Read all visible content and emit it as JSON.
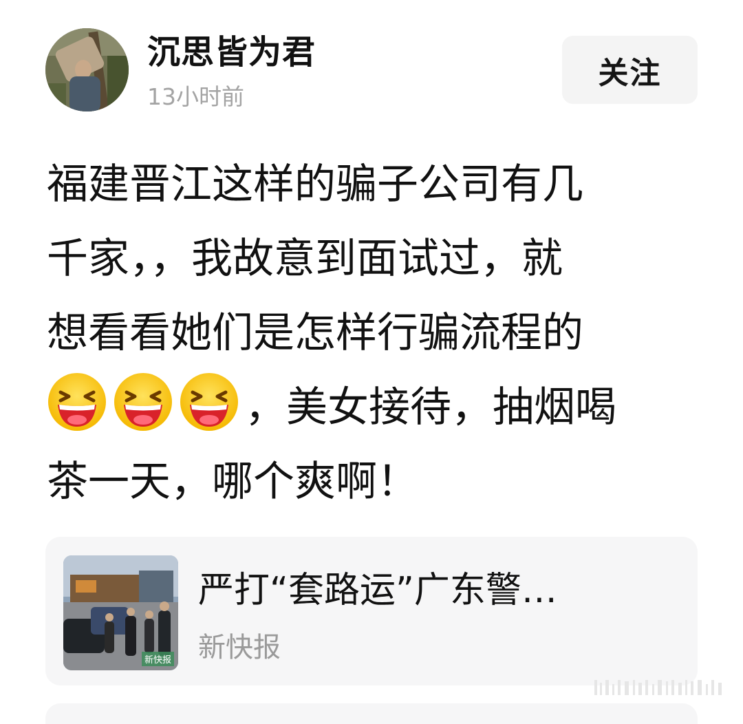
{
  "author": {
    "name": "沉思皆为君",
    "time": "13小时前"
  },
  "actions": {
    "follow_label": "关注"
  },
  "post": {
    "line1": "福建晋江这样的骗子公司有几",
    "line2": "千家，，我故意到面试过，就",
    "line3": "想看看她们是怎样行骗流程的",
    "line4_text": "，美女接待，抽烟喝",
    "line5": "茶一天，哪个爽啊！",
    "emojis": [
      "laughing-face-icon",
      "laughing-face-icon",
      "laughing-face-icon"
    ]
  },
  "card": {
    "title": "严打“套路运”广东警…",
    "source": "新快报",
    "thumb_watermark": "新快报"
  },
  "colors": {
    "text": "#111111",
    "muted": "#a3a3a3",
    "card_bg": "#f6f6f7",
    "button_bg": "#f4f4f4"
  }
}
